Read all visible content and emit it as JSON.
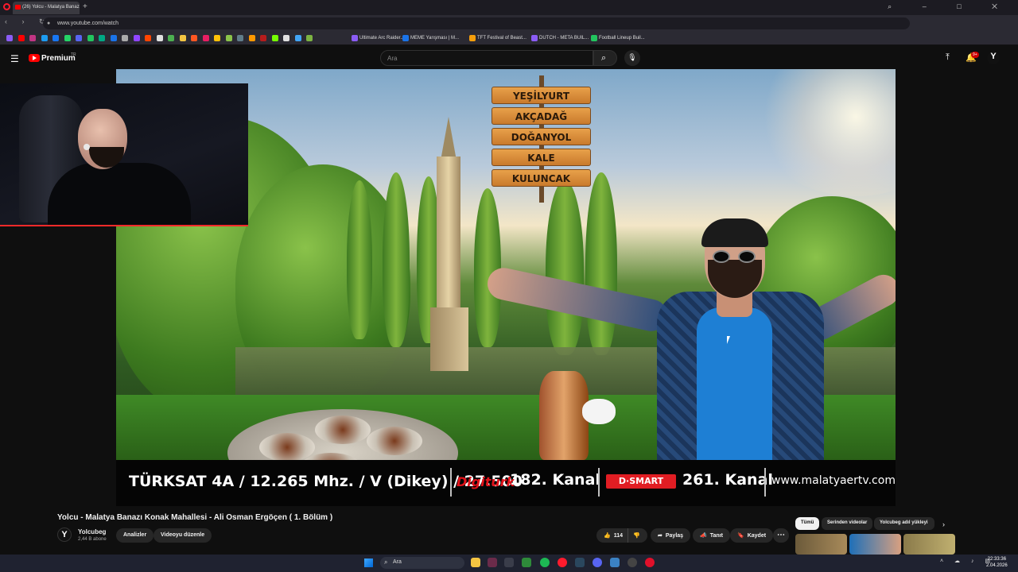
{
  "browser": {
    "tab_title": "(26) Yolcu - Malatya Banaz",
    "new_tab_symbol": "+",
    "window_controls": "⌕ – □ ✕",
    "nav_symbols": "‹ › ↻",
    "url": "www.youtube.com/watch",
    "bookmarks": [
      {
        "label": "Ultimate Arc Raider...",
        "color": "#8b5cf6"
      },
      {
        "label": "MEME Yarışması | M...",
        "color": "#1a73e8"
      },
      {
        "label": "TFT Festival of Beast...",
        "color": "#f59e0b"
      },
      {
        "label": "DUTCH - META BUIL...",
        "color": "#8b5cf6"
      },
      {
        "label": "Football Lineup Buil...",
        "color": "#22c55e"
      }
    ]
  },
  "youtube": {
    "menu_icon": "menu-icon",
    "logo_text": "Premium",
    "country_code": "TR",
    "search_placeholder": "Ara",
    "search_icon": "⌕",
    "mic_icon": "🎙",
    "upload_icon": "⤒",
    "bell_icon": "🔔",
    "notification_count": "9+",
    "avatar_letter": "Y",
    "brand_color": "#ff0000"
  },
  "video": {
    "signs": [
      "YEŞİLYURT",
      "AKÇADAĞ",
      "DOĞANYOL",
      "KALE",
      "KULUNCAK"
    ],
    "ticker": {
      "satellite": "TÜRKSAT 4A / 12.265 Mhz. / V (Dikey) / 27.500",
      "digiturk": "Digiturk",
      "digiturk_channel": "182. Kanal",
      "dsmart": "D·SMART",
      "dsmart_channel": "261. Kanal",
      "website": "www.malatyaertv.com"
    }
  },
  "info": {
    "title": "Yolcu - Malatya Banazı Konak Mahallesi - Ali Osman Ergöçen ( 1. Bölüm )",
    "channel_avatar": "Y",
    "channel_name": "Yolcubeg",
    "subscribers": "2,44 B abone",
    "analytics_label": "Analizler",
    "edit_label": "Videoyu düzenle",
    "like_count": "114",
    "like_icon": "👍",
    "dislike_icon": "👎",
    "share_label": "Paylaş",
    "share_icon": "➦",
    "promote_label": "Tanıt",
    "promote_icon": "📣",
    "save_label": "Kaydet",
    "save_icon": "🔖",
    "more_icon": "⋯"
  },
  "chips": {
    "all": "Tümü",
    "series": "Serinden videolar",
    "uploaded": "Yolcubeg adıl yükleyi",
    "next_icon": "›"
  },
  "taskbar": {
    "search_label": "Ara",
    "search_icon": "⌕",
    "tray_symbols": "˄ ☁ ♪ ▤",
    "time": "22:33:36",
    "date": "2.04.2026"
  }
}
